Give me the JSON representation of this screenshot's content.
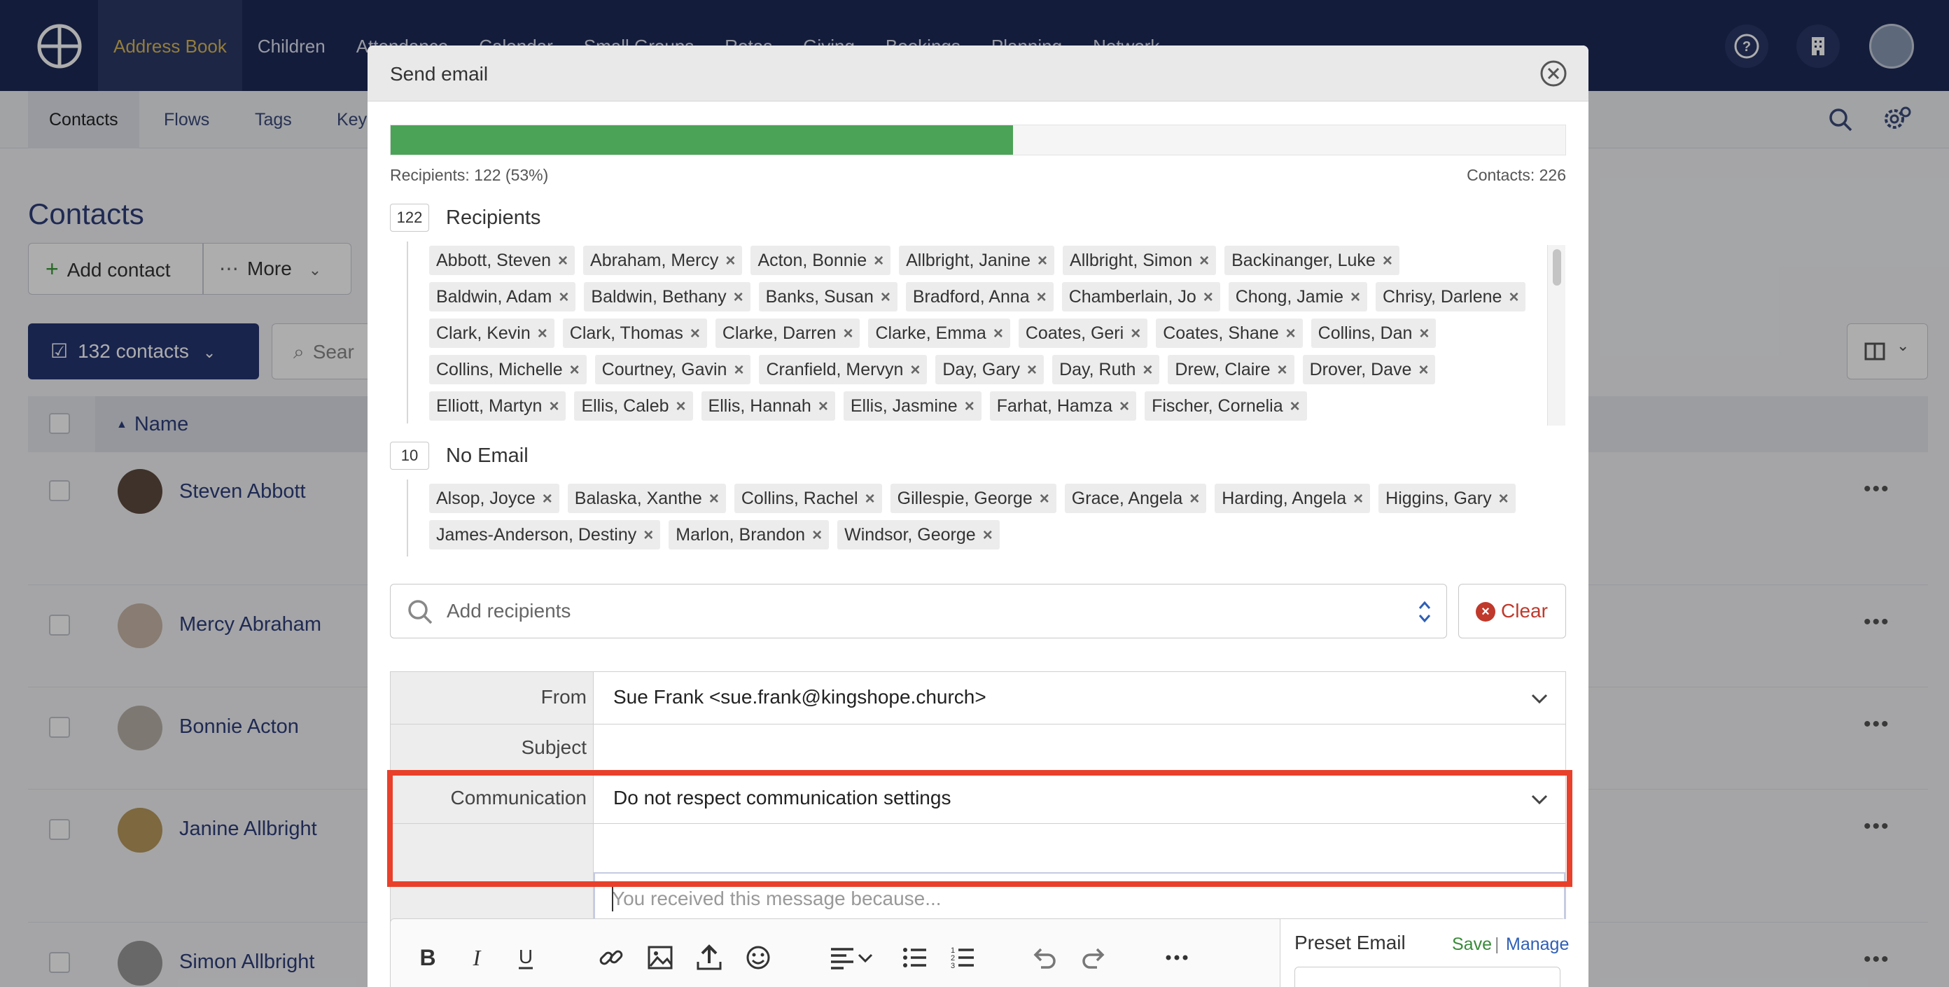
{
  "app": {
    "nav": [
      "Address Book",
      "Children",
      "Attendance",
      "Calendar",
      "Small Groups",
      "Rotas",
      "Giving",
      "Bookings",
      "Planning",
      "Network"
    ],
    "subnav": [
      "Contacts",
      "Flows",
      "Tags",
      "Key"
    ],
    "page_title": "Contacts",
    "add_contact": "Add contact",
    "more": "More",
    "contacts_selected": "132 contacts",
    "search_placeholder": "Sear",
    "name_header": "Name",
    "rows": [
      {
        "name": "Steven Abbott",
        "frag": "m"
      },
      {
        "name": "Mercy Abraham",
        "frag": "m"
      },
      {
        "name": "Bonnie Acton",
        "frag": "m"
      },
      {
        "name": "Janine Allbright",
        "frag": ""
      },
      {
        "name": "Simon Allbright",
        "frag": ""
      }
    ]
  },
  "modal": {
    "title": "Send email",
    "progress_percent": 53,
    "recipients_summary": "Recipients: 122 (53%)",
    "contacts_summary": "Contacts: 226",
    "recipients_count": "122",
    "recipients_label": "Recipients",
    "recipients": [
      "Abbott, Steven",
      "Abraham, Mercy",
      "Acton, Bonnie",
      "Allbright, Janine",
      "Allbright, Simon",
      "Backinanger, Luke",
      "Baldwin, Adam",
      "Baldwin, Bethany",
      "Banks, Susan",
      "Bradford, Anna",
      "Chamberlain, Jo",
      "Chong, Jamie",
      "Chrisy, Darlene",
      "Clark, Kevin",
      "Clark, Thomas",
      "Clarke, Darren",
      "Clarke, Emma",
      "Coates, Geri",
      "Coates, Shane",
      "Collins, Dan",
      "Collins, Michelle",
      "Courtney, Gavin",
      "Cranfield, Mervyn",
      "Day, Gary",
      "Day, Ruth",
      "Drew, Claire",
      "Drover, Dave",
      "Elliott, Martyn",
      "Ellis, Caleb",
      "Ellis, Hannah",
      "Ellis, Jasmine",
      "Farhat, Hamza",
      "Fischer, Cornelia"
    ],
    "no_email_count": "10",
    "no_email_label": "No Email",
    "no_email": [
      "Alsop, Joyce",
      "Balaska, Xanthe",
      "Collins, Rachel",
      "Gillespie, George",
      "Grace, Angela",
      "Harding, Angela",
      "Higgins, Gary",
      "James-Anderson, Destiny",
      "Marlon, Brandon",
      "Windsor, George"
    ],
    "add_recipients_placeholder": "Add recipients",
    "clear_label": "Clear",
    "form": {
      "from_label": "From",
      "from_value": "Sue Frank <sue.frank@kingshope.church>",
      "subject_label": "Subject",
      "subject_value": "",
      "communication_label": "Communication",
      "communication_value": "Do not respect communication settings",
      "reason_placeholder": "You received this message because..."
    },
    "preset": {
      "title": "Preset Email",
      "save": "Save",
      "separator": "|",
      "manage": "Manage"
    }
  },
  "colors": {
    "nav_bg": "#1e2a57",
    "progress_fill": "#4aa356",
    "highlight": "#e8402a",
    "clear_red": "#c0392b"
  }
}
